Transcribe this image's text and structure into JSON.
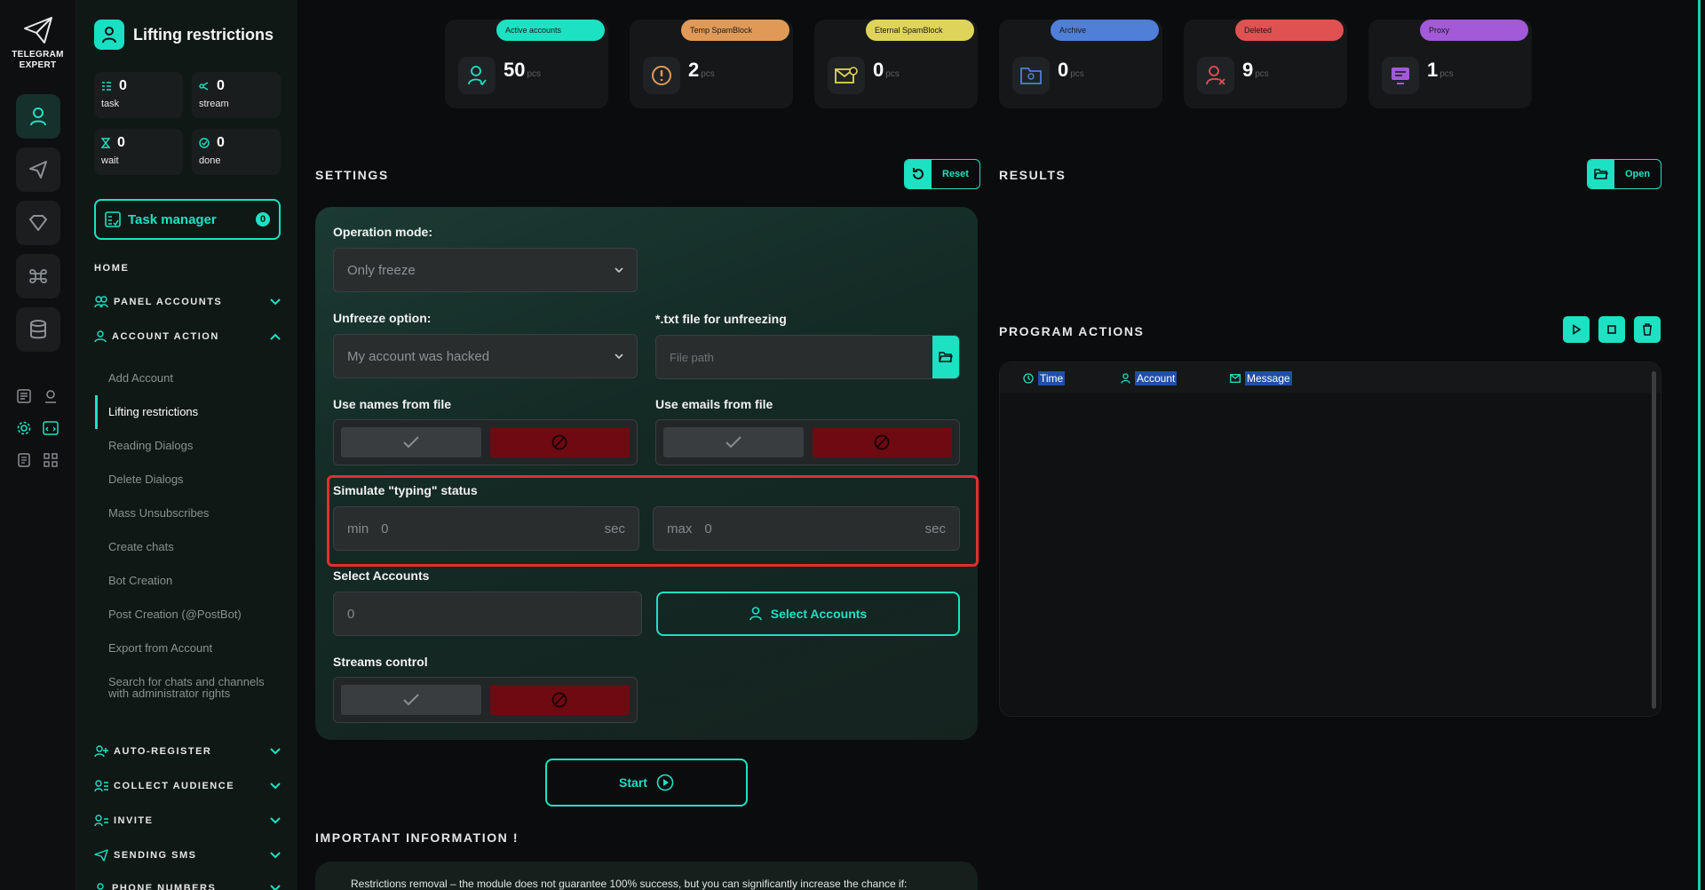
{
  "app": {
    "brand_line1": "TELEGRAM",
    "brand_line2": "EXPERT",
    "module_title": "Lifting restrictions"
  },
  "stats": [
    {
      "value": "0",
      "label": "task"
    },
    {
      "value": "0",
      "label": "stream"
    },
    {
      "value": "0",
      "label": "wait"
    },
    {
      "value": "0",
      "label": "done"
    }
  ],
  "task_manager": {
    "label": "Task manager",
    "badge": "0"
  },
  "sidebar": {
    "home": "HOME",
    "panel_accounts": "PANEL ACCOUNTS",
    "account_action": "ACCOUNT ACTION",
    "items": [
      "Add Account",
      "Lifting restrictions",
      "Reading Dialogs",
      "Delete Dialogs",
      "Mass Unsubscribes",
      "Create chats",
      "Bot Creation",
      "Post Creation (@PostBot)",
      "Export from Account",
      "Search for chats and channels with administrator rights"
    ],
    "auto_register": "AUTO-REGISTER",
    "collect_audience": "COLLECT AUDIENCE",
    "invite": "INVITE",
    "sending_sms": "SENDING SMS",
    "phone_numbers": "PHONE NUMBERS"
  },
  "cards": [
    {
      "label": "Active accounts",
      "value": "50",
      "unit": "pcs",
      "color": "#1de1c3"
    },
    {
      "label": "Temp SpamBlock",
      "value": "2",
      "unit": "pcs",
      "color": "#e09a57"
    },
    {
      "label": "Eternal SpamBlock",
      "value": "0",
      "unit": "pcs",
      "color": "#dfd45a"
    },
    {
      "label": "Archive",
      "value": "0",
      "unit": "pcs",
      "color": "#4f7fd6"
    },
    {
      "label": "Deleted",
      "value": "9",
      "unit": "pcs",
      "color": "#e05252"
    },
    {
      "label": "Proxy",
      "value": "1",
      "unit": "pcs",
      "color": "#a25ad8"
    }
  ],
  "settings": {
    "title": "SETTINGS",
    "reset_label": "Reset",
    "operation_mode_label": "Operation mode:",
    "operation_mode_value": "Only freeze",
    "unfreeze_label": "Unfreeze option:",
    "unfreeze_value": "My account was hacked",
    "txt_label": "*.txt file for unfreezing",
    "file_placeholder": "File path",
    "names_label": "Use names from file",
    "emails_label": "Use emails from file",
    "typing_label": "Simulate \"typing\" status",
    "min_prefix": "min",
    "min_value": "0",
    "max_prefix": "max",
    "max_value": "0",
    "unit": "sec",
    "select_accounts_label": "Select Accounts",
    "select_accounts_value": "0",
    "select_accounts_button": "Select Accounts",
    "streams_label": "Streams control",
    "start_label": "Start"
  },
  "results": {
    "title": "RESULTS",
    "open_label": "Open"
  },
  "program_actions": {
    "title": "PROGRAM ACTIONS",
    "columns": [
      "Time",
      "Account",
      "Message"
    ]
  },
  "important": {
    "title": "IMPORTANT INFORMATION !",
    "text": "Restrictions removal – the module does not guarantee 100% success, but you can significantly increase the chance if:"
  },
  "colors": {
    "accent": "#1de1c3",
    "danger": "#6e0a12",
    "highlight": "#e0302e"
  }
}
